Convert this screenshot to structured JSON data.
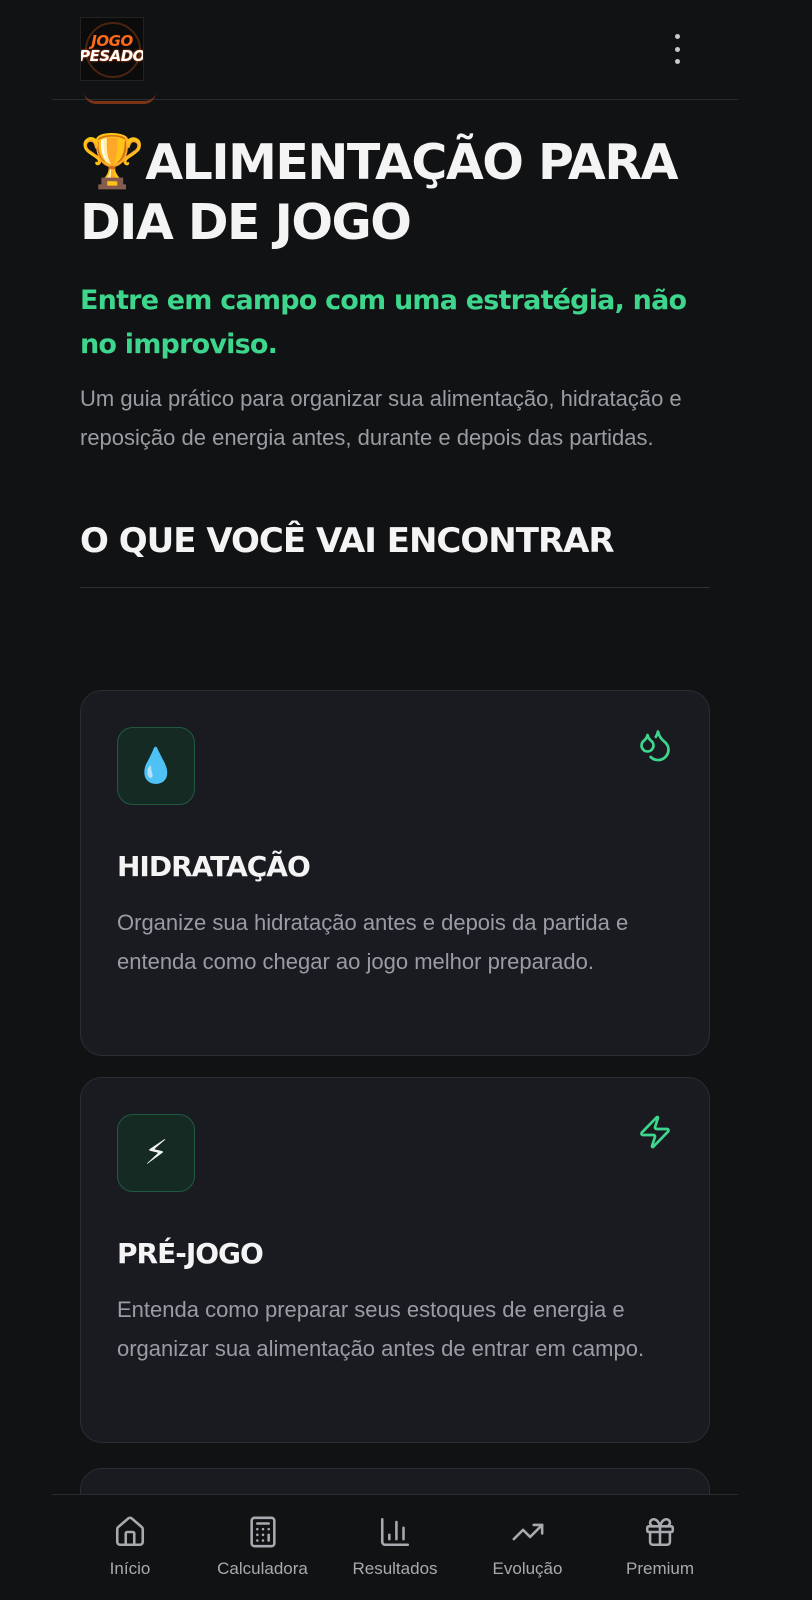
{
  "header": {
    "logo_line1": "JOGO",
    "logo_line2": "PESADO",
    "menu_icon": "kebab-menu-icon"
  },
  "hero": {
    "emoji": "🏆",
    "title": "ALIMENTAÇÃO PARA DIA DE JOGO",
    "subtitle": "Entre em campo com uma estratégia, não no improviso.",
    "description": "Um guia prático para organizar sua alimentação, hidratação e reposição de energia antes, durante e depois das partidas."
  },
  "section": {
    "title": "O QUE VOCÊ VAI ENCONTRAR"
  },
  "cards": [
    {
      "emoji": "💧",
      "corner_icon": "droplets-icon",
      "title": "HIDRATAÇÃO",
      "text": "Organize sua hidratação antes e depois da partida e entenda como chegar ao jogo melhor preparado."
    },
    {
      "emoji": "⚡",
      "corner_icon": "zap-icon",
      "title": "PRÉ-JOGO",
      "text": "Entenda como preparar seus estoques de energia e organizar sua alimentação antes de entrar em campo."
    }
  ],
  "bottom_nav": [
    {
      "label": "Início",
      "icon": "home-icon"
    },
    {
      "label": "Calculadora",
      "icon": "calculator-icon"
    },
    {
      "label": "Resultados",
      "icon": "bar-chart-icon"
    },
    {
      "label": "Evolução",
      "icon": "trending-up-icon"
    },
    {
      "label": "Premium",
      "icon": "gift-icon"
    }
  ],
  "colors": {
    "background": "#111214",
    "card": "#1a1b20",
    "accent_green": "#3dd68c",
    "muted_text": "#9a9ca3",
    "logo_orange": "#ff6a1a"
  }
}
